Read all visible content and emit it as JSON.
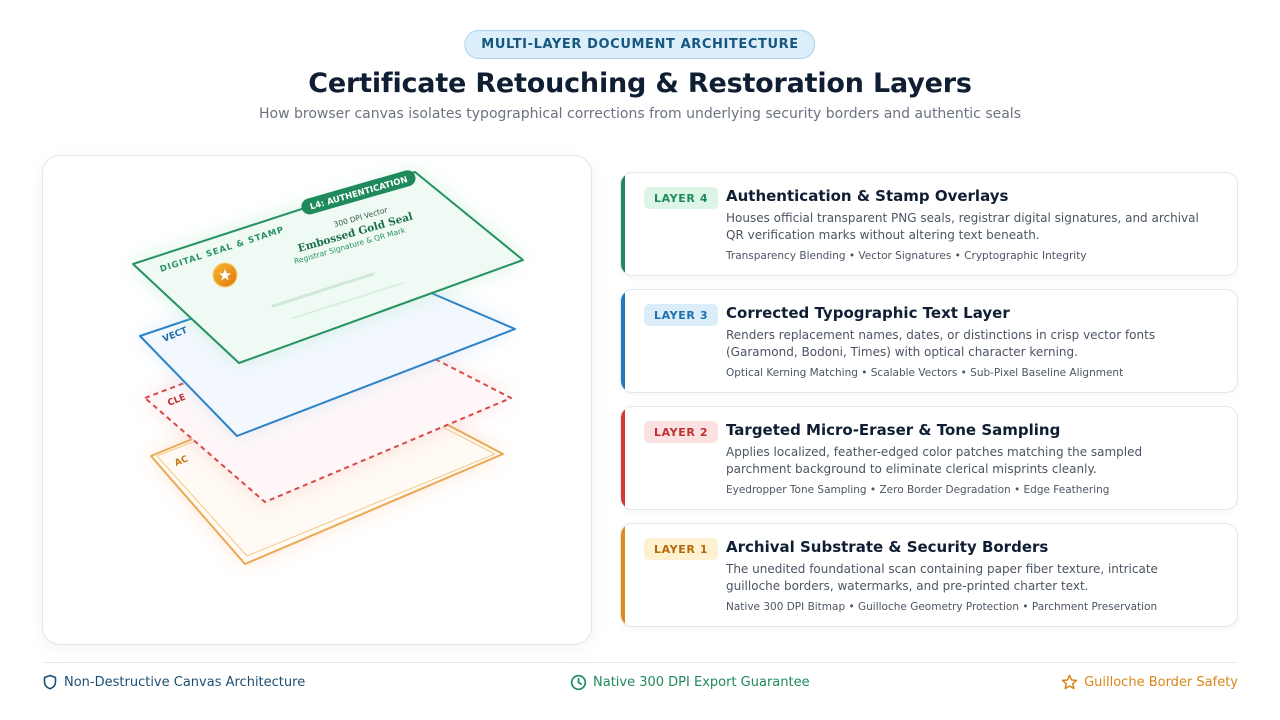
{
  "header": {
    "eyebrow": "MULTI-LAYER DOCUMENT ARCHITECTURE",
    "title": "Certificate Retouching & Restoration Layers",
    "subtitle": "How browser canvas isolates typographical corrections from underlying security borders and authentic seals"
  },
  "stack": {
    "top_plate": {
      "tag": "L4: AUTHENTICATION",
      "tag_sub": "300 DPI Vector",
      "label": "DIGITAL SEAL & STAMP",
      "seal_title": "Embossed Gold Seal",
      "seal_sub": "Registrar Signature & QR Mark",
      "seal_icon": "star-icon"
    },
    "plate3_label": "VECT",
    "plate2_label": "CLE",
    "plate1_label": "AC"
  },
  "layers": [
    {
      "badge": "LAYER 4",
      "title": "Authentication & Stamp Overlays",
      "description": "Houses official transparent PNG seals, registrar digital signatures, and archival QR verification marks without altering text beneath.",
      "tags": "Transparency Blending • Vector Signatures • Cryptographic Integrity",
      "accent": "#1f8a5b",
      "badge_bg": "#dcf5e6",
      "badge_fg": "#1f8a5b"
    },
    {
      "badge": "LAYER 3",
      "title": "Corrected Typographic Text Layer",
      "description": "Renders replacement names, dates, or distinctions in crisp vector fonts (Garamond, Bodoni, Times) with optical character kerning.",
      "tags": "Optical Kerning Matching • Scalable Vectors • Sub-Pixel Baseline Alignment",
      "accent": "#1e7bc0",
      "badge_bg": "#dcedfa",
      "badge_fg": "#1e6fae"
    },
    {
      "badge": "LAYER 2",
      "title": "Targeted Micro-Eraser & Tone Sampling",
      "description": "Applies localized, feather-edged color patches matching the sampled parchment background to eliminate clerical misprints cleanly.",
      "tags": "Eyedropper Tone Sampling • Zero Border Degradation • Edge Feathering",
      "accent": "#d43838",
      "badge_bg": "#fbe1e1",
      "badge_fg": "#c03030"
    },
    {
      "badge": "LAYER 1",
      "title": "Archival Substrate & Security Borders",
      "description": "The unedited foundational scan containing paper fiber texture, intricate guilloche borders, watermarks, and pre-printed charter text.",
      "tags": "Native 300 DPI Bitmap • Guilloche Geometry Protection • Parchment Preservation",
      "accent": "#e08a1e",
      "badge_bg": "#fdf1cf",
      "badge_fg": "#b5680c"
    }
  ],
  "footer": {
    "left": {
      "label": "Non-Destructive Canvas Architecture",
      "icon": "shield-icon",
      "color": "#1d4f73"
    },
    "center": {
      "label": "Native 300 DPI Export Guarantee",
      "icon": "clock-icon",
      "color": "#1f8a5b"
    },
    "right": {
      "label": "Guilloche Border Safety",
      "icon": "star-icon",
      "color": "#d8861a"
    }
  }
}
